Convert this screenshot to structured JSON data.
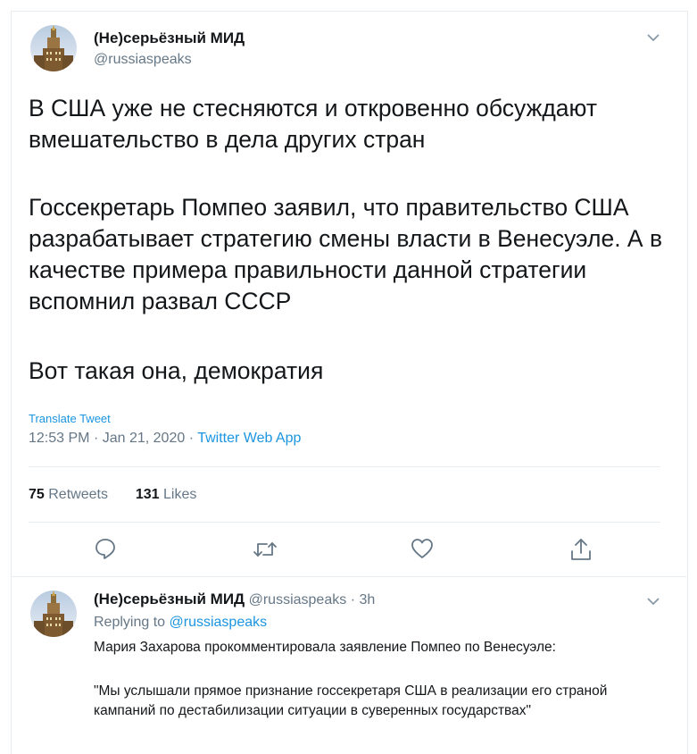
{
  "tweet": {
    "author_name": "(Не)серьёзный МИД",
    "author_handle": "@russiaspeaks",
    "paragraphs": [
      "В США уже не стесняются и откровенно обсуждают вмешательство в дела других стран",
      "Госсекретарь Помпео заявил, что правительство США разрабатывает стратегию смены власти в Венесуэле. А в качестве примера правильности данной стратегии вспомнил развал СССР",
      "Вот такая она, демократия"
    ],
    "translate_label": "Translate Tweet",
    "time": "12:53 PM",
    "date": "Jan 21, 2020",
    "source": "Twitter Web App",
    "retweets_count": "75",
    "retweets_label": "Retweets",
    "likes_count": "131",
    "likes_label": "Likes"
  },
  "actions": [
    "reply-icon",
    "retweet-icon",
    "like-icon",
    "share-icon"
  ],
  "reply": {
    "author_name": "(Не)серьёзный МИД",
    "author_handle": "@russiaspeaks",
    "time_ago": "3h",
    "replying_prefix": "Replying to",
    "replying_handle": "@russiaspeaks",
    "paragraphs": [
      "Мария Захарова прокомментировала заявление Помпео по Венесуэле:",
      "\"Мы услышали прямое признание госсекретаря США в реализации его страной кампаний по дестабилизации ситуации в суверенных государствах\""
    ]
  },
  "colors": {
    "link": "#1b95e0",
    "muted": "#657786",
    "border": "#e6ecf0"
  }
}
